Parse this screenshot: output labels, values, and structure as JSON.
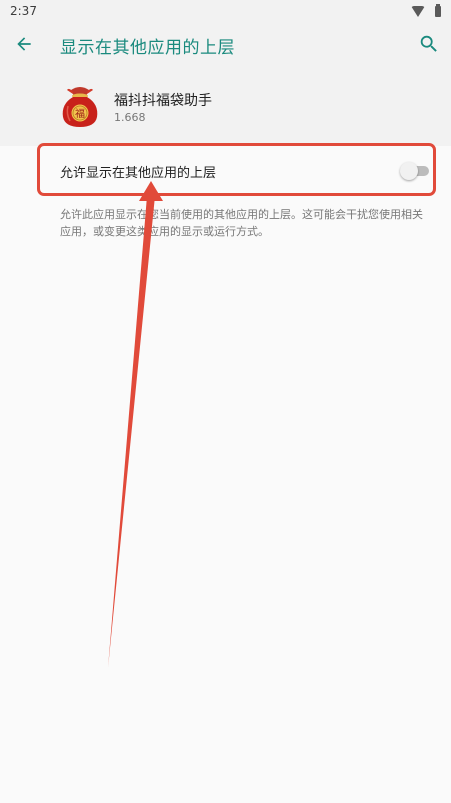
{
  "status_bar": {
    "time": "2:37",
    "wifi_icon": "wifi-icon",
    "battery_icon": "battery-icon"
  },
  "toolbar": {
    "back_icon": "arrow-back-icon",
    "title": "显示在其他应用的上层",
    "search_icon": "search-icon"
  },
  "app": {
    "name": "福抖抖福袋助手",
    "version": "1.668",
    "icon": "lucky-bag-icon",
    "icon_glyph": "福"
  },
  "setting": {
    "label": "允许显示在其他应用的上层",
    "enabled": false
  },
  "description": "允许此应用显示在您当前使用的其他应用的上层。这可能会干扰您使用相关应用，或变更这类应用的显示或运行方式。",
  "colors": {
    "accent": "#1a8a7e",
    "annotation": "#e14a3a",
    "header_bg": "#f2f2f2",
    "page_bg": "#fafafa"
  }
}
